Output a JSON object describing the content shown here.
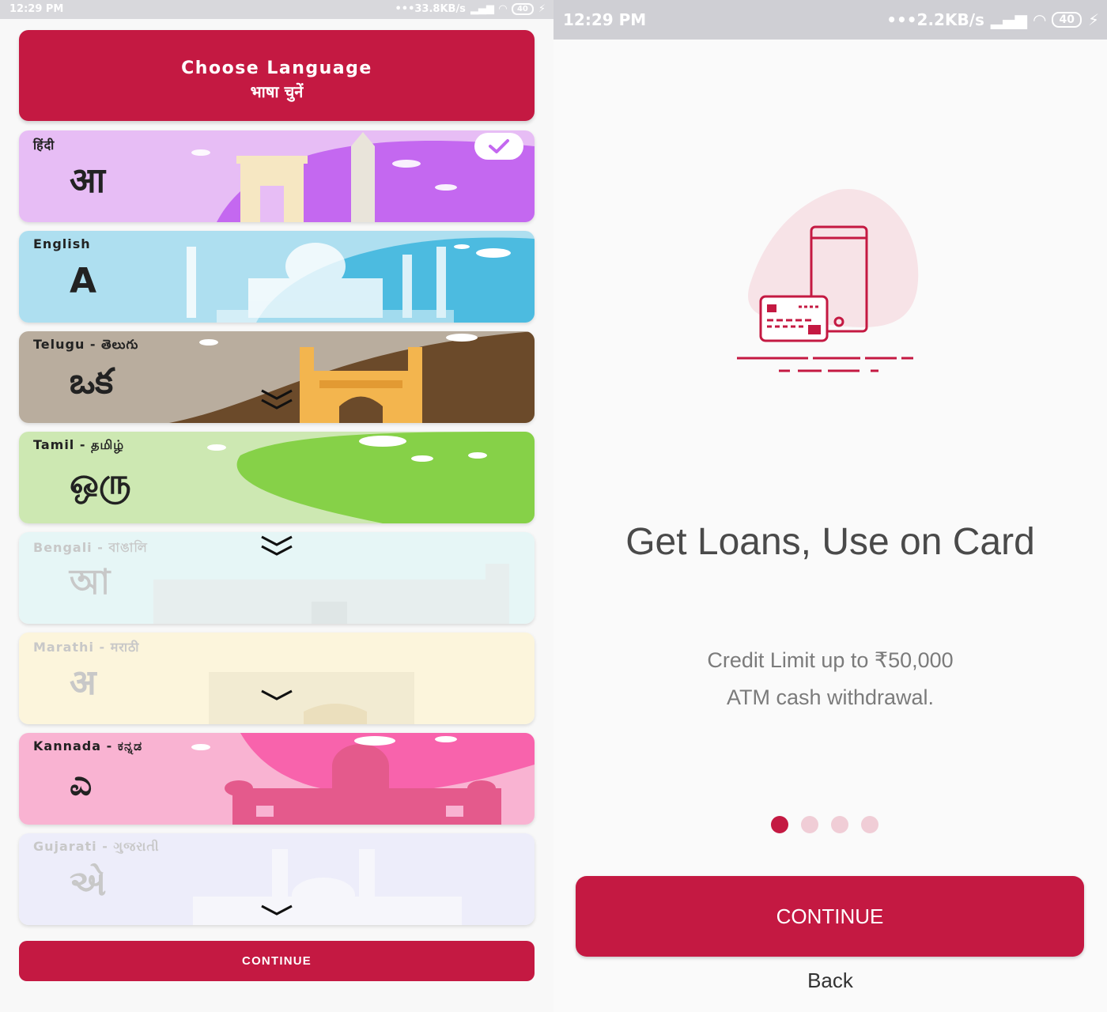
{
  "left_screen": {
    "status_bar": {
      "time": "12:29 PM",
      "speed": "•••33.8KB/s",
      "battery": "40"
    },
    "header": {
      "title": "Choose Language",
      "subtitle": "भाषा चुनें"
    },
    "languages": [
      {
        "name": "हिंदी",
        "glyph": "आ",
        "selected": true,
        "bg": "#e7bdf5",
        "accent": "#c468f0"
      },
      {
        "name": "English",
        "glyph": "A",
        "selected": false,
        "bg": "#aedff0",
        "accent": "#4cbbe0"
      },
      {
        "name": "Telugu - తెలుగు",
        "glyph": "ఒక",
        "selected": false,
        "bg": "#b9ad9e",
        "accent": "#6b4a2a"
      },
      {
        "name": "Tamil - தமிழ்",
        "glyph": "ஒரு",
        "selected": false,
        "bg": "#cde8b2",
        "accent": "#86d148"
      },
      {
        "name": "Bengali - বাঙালি",
        "glyph": "আ",
        "selected": false,
        "bg": "#e6f6f6",
        "accent": "#d8eef2"
      },
      {
        "name": "Marathi - मराठी",
        "glyph": "अ",
        "selected": false,
        "bg": "#fcf5dc",
        "accent": "#f7ecc8"
      },
      {
        "name": "Kannada - ಕನ್ನಡ",
        "glyph": "ಎ",
        "selected": false,
        "bg": "#f9b3d2",
        "accent": "#f863ac"
      },
      {
        "name": "Gujarati - ગુજરાતી",
        "glyph": "એ",
        "selected": false,
        "bg": "#ededfa",
        "accent": "#dfe0fb"
      }
    ],
    "continue_label": "CONTINUE"
  },
  "right_screen": {
    "status_bar": {
      "time": "12:29 PM",
      "speed": "•••2.2KB/s",
      "battery": "40"
    },
    "headline": "Get Loans, Use on Card",
    "subtext_line1": "Credit Limit up to ₹50,000",
    "subtext_line2": "ATM cash withdrawal.",
    "pager": {
      "total": 4,
      "active": 1
    },
    "continue_label": "CONTINUE",
    "back_label": "Back"
  },
  "colors": {
    "brand": "#c41942",
    "dot_inactive": "#f0cdd6"
  }
}
